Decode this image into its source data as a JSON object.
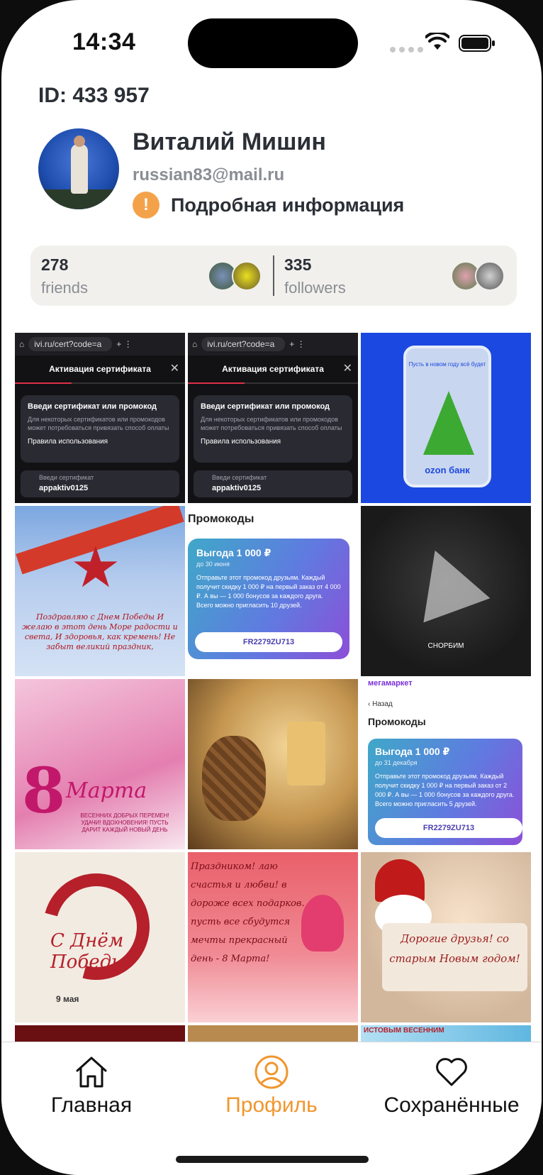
{
  "status": {
    "time": "14:34"
  },
  "profile": {
    "id_label": "ID: 433 957",
    "name": "Виталий Мишин",
    "email": "russian83@mail.ru",
    "info_label": "Подробная информация",
    "info_icon_glyph": "!"
  },
  "stats": {
    "friends_count": "278",
    "friends_label": "friends",
    "followers_count": "335",
    "followers_label": "followers"
  },
  "tiles": {
    "cert": {
      "url": "ivi.ru/cert?code=a",
      "title": "Активация сертификата",
      "box_title": "Введи сертификат или промокод",
      "box_text": "Для некоторых сертификатов или промокодов может потребоваться привязать способ оплаты",
      "rules": "Правила использования",
      "input_label": "Введи сертификат",
      "input_value": "appaktiv0125"
    },
    "ozon": {
      "card_text": "Пусть в новом году всё будет",
      "brand": "ozon банк"
    },
    "victory1": {
      "verse": "Поздравляю с Днем Победы И желаю в этот день Море радости и света, И здоровья, как кремень! Не забыт великий праздник,"
    },
    "promo": {
      "title": "Промокоды",
      "benefit": "Выгода 1 000 ₽",
      "date": "до 30 июня",
      "text": "Отправьте этот промокод друзьям. Каждый получит скидку 1 000 ₽ на первый заказ от 4 000 ₽. А вы — 1 000 бонусов за каждого друга. Всего можно пригласить 10 друзей.",
      "code": "FR2279ZU713"
    },
    "crane": {
      "text": "СНОРБИМ"
    },
    "march8": {
      "number": "8",
      "word": "Марта",
      "line": "ВЕСЕННИХ ДОБРЫХ ПЕРЕМЕН! УДАЧИ! ВДОХНОВЕНИЯ! ПУСТЬ ДАРИТ КАЖДЫЙ НОВЫЙ ДЕНЬ"
    },
    "mega": {
      "header": "мегамаркет",
      "back": "Назад",
      "title": "Промокоды",
      "benefit": "Выгода 1 000 ₽",
      "date": "до 31 декабря",
      "text": "Отправьте этот промокод друзьям. Каждый получит скидку 1 000 ₽ на первый заказ от 2 000 ₽. А вы — 1 000 бонусов за каждого друга. Всего можно пригласить 5 друзей.",
      "code": "FR2279ZU713"
    },
    "victory2": {
      "text": "С Днём Победы!",
      "date": "9 мая"
    },
    "tulips": {
      "text": "Праздником! лаю счастья и любви! в дороже всех подарков. пусть все сбудутся мечты прекрасный день - 8 Марта!"
    },
    "snow": {
      "text": "Дорогие друзья! со старым Новым годом!"
    },
    "partial_text": "ИСТОВЫМ ВЕСЕННИМ"
  },
  "tabs": {
    "home": "Главная",
    "profile": "Профиль",
    "saved": "Сохранённые"
  },
  "colors": {
    "accent": "#f0962d",
    "text": "#2b2f36",
    "muted": "#8a8d93"
  }
}
